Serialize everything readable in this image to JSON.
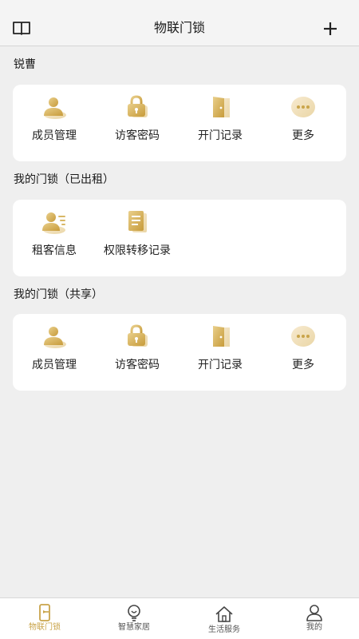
{
  "header": {
    "title": "物联门锁"
  },
  "sections": [
    {
      "title": "锐曹",
      "items": [
        {
          "label": "成员管理",
          "icon": "member-icon"
        },
        {
          "label": "访客密码",
          "icon": "lock-icon"
        },
        {
          "label": "开门记录",
          "icon": "door-icon"
        },
        {
          "label": "更多",
          "icon": "more-icon"
        }
      ]
    },
    {
      "title": "我的门锁（已出租）",
      "items": [
        {
          "label": "租客信息",
          "icon": "tenant-info-icon"
        },
        {
          "label": "权限转移记录",
          "icon": "document-icon"
        }
      ]
    },
    {
      "title": "我的门锁（共享）",
      "items": [
        {
          "label": "成员管理",
          "icon": "member-icon"
        },
        {
          "label": "访客密码",
          "icon": "lock-icon"
        },
        {
          "label": "开门记录",
          "icon": "door-icon"
        },
        {
          "label": "更多",
          "icon": "more-icon"
        }
      ]
    }
  ],
  "tabbar": [
    {
      "label": "物联门锁",
      "icon": "phone-lock-icon",
      "active": true
    },
    {
      "label": "智慧家居",
      "icon": "bulb-icon",
      "active": false
    },
    {
      "label": "生活服务",
      "icon": "house-icon",
      "active": false
    },
    {
      "label": "我的",
      "icon": "user-icon",
      "active": false
    }
  ],
  "colors": {
    "accent": "#c9a44a",
    "background": "#efefef",
    "card": "#ffffff"
  }
}
